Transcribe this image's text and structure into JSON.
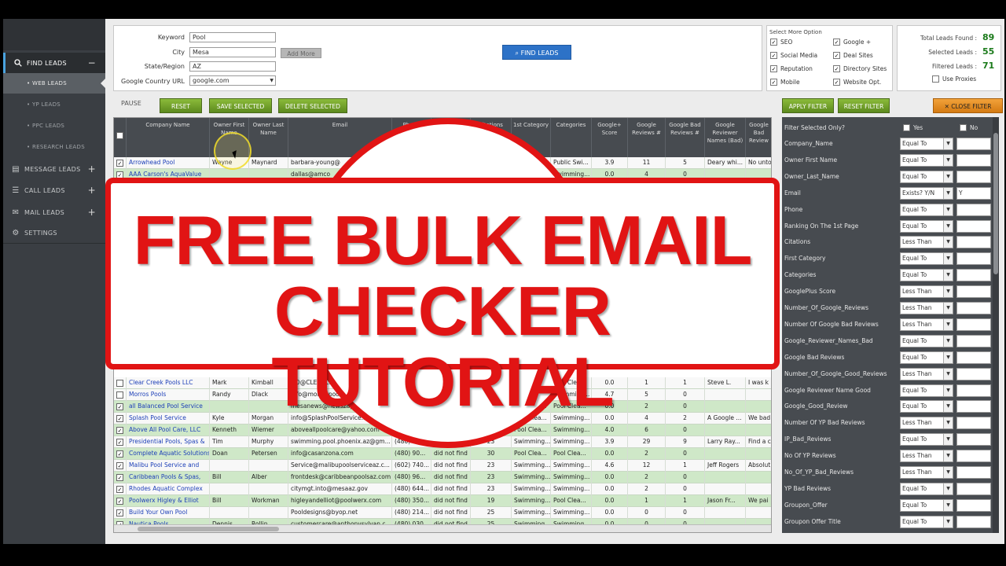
{
  "sidebar": {
    "items": [
      {
        "label": "FIND LEADS",
        "icon": "search-icon",
        "toggle": "−"
      },
      {
        "label": "MESSAGE LEADS",
        "icon": "chat-icon",
        "toggle": "+"
      },
      {
        "label": "CALL LEADS",
        "icon": "phone-list-icon",
        "toggle": "+"
      },
      {
        "label": "MAIL LEADS",
        "icon": "mail-icon",
        "toggle": "+"
      },
      {
        "label": "SETTINGS",
        "icon": "gear-icon",
        "toggle": ""
      }
    ],
    "sub_items": [
      "WEB LEADS",
      "YP LEADS",
      "PPC LEADS",
      "RESEARCH LEADS"
    ]
  },
  "search": {
    "keyword_label": "Keyword",
    "keyword_value": "Pool",
    "city_label": "City",
    "city_value": "Mesa",
    "state_label": "State/Region",
    "state_value": "AZ",
    "country_label": "Google Country URL",
    "country_value": "google.com",
    "add_more": "Add More",
    "find_leads": "FIND LEADS"
  },
  "options": {
    "title": "Select More Option",
    "items": [
      "SEO",
      "Google +",
      "Social Media",
      "Deal Sites",
      "Reputation",
      "Directory Sites",
      "Mobile",
      "Website Opt."
    ]
  },
  "totals": {
    "total_label": "Total Leads Found :",
    "total_value": "89",
    "selected_label": "Selected Leads :",
    "selected_value": "55",
    "filtered_label": "Filtered Leads :",
    "filtered_value": "71",
    "use_proxies": "Use Proxies"
  },
  "toolbar": {
    "pause": "PAUSE",
    "reset": "RESET",
    "save_selected": "SAVE SELECTED",
    "delete_selected": "DELETE SELECTED",
    "apply_filter": "APPLY FILTER",
    "reset_filter": "RESET FILTER",
    "close_filter": "CLOSE FILTER"
  },
  "grid": {
    "columns": [
      "Company Name",
      "Owner First Name",
      "Owner Last Name",
      "Email",
      "Phone",
      "Ranking",
      "Citations",
      "1st Category",
      "Categories",
      "Google+ Score",
      "Google Reviews #",
      "Google Bad Reviews #",
      "Google Reviewer Names (Bad)",
      "Google Bad Review"
    ],
    "top_rows": [
      {
        "checked": true,
        "green": false,
        "company": "Arrowhead Pool",
        "first": "Wayne",
        "last": "Maynard",
        "email": "barbara-young@",
        "phone": "",
        "rank": "",
        "cit": "",
        "cat1": "",
        "cats": "Public Swi...",
        "gscore": "3.9",
        "grev": "11",
        "gbad": "5",
        "gnames": "Deary whi...",
        "gbadrev": "No unto"
      },
      {
        "checked": true,
        "green": true,
        "company": "AAA Carson's AquaValue",
        "first": "",
        "last": "",
        "email": "dallas@amco",
        "phone": "",
        "rank": "",
        "cit": "",
        "cat1": "",
        "cats": "Swimming...",
        "gscore": "0.0",
        "grev": "4",
        "gbad": "0",
        "gnames": "",
        "gbadrev": ""
      }
    ],
    "rows": [
      {
        "checked": false,
        "green": false,
        "company": "Clear Creek Pools LLC",
        "first": "Mark",
        "last": "Kimball",
        "email": "GO@CLEARCR",
        "phone": "",
        "rank": "",
        "cit": "",
        "cat1": "",
        "cats": "Pool Clea...",
        "gscore": "0.0",
        "grev": "1",
        "gbad": "1",
        "gnames": "Steve L.",
        "gbadrev": "I was k"
      },
      {
        "checked": false,
        "green": false,
        "company": "Morros Pools",
        "first": "Randy",
        "last": "Dlack",
        "email": "info@morrospools.",
        "phone": "",
        "rank": "",
        "cit": "",
        "cat1": "",
        "cats": "Swimming...",
        "gscore": "4.7",
        "grev": "5",
        "gbad": "0",
        "gnames": "",
        "gbadrev": ""
      },
      {
        "checked": true,
        "green": true,
        "company": "all Balanced Pool Service",
        "first": "",
        "last": "",
        "email": "mesanews@newszap.com",
        "phone": "",
        "rank": "",
        "cit": "",
        "cat1": "Pool Clea...",
        "cats": "Pool Clea...",
        "gscore": "0.0",
        "grev": "2",
        "gbad": "0",
        "gnames": "",
        "gbadrev": ""
      },
      {
        "checked": true,
        "green": false,
        "company": "Splash Pool Service",
        "first": "Kyle",
        "last": "Morgan",
        "email": "info@SplashPoolService.into",
        "phone": "",
        "rank": "",
        "cit": "",
        "cat1": "Pool Clea...",
        "cats": "Swimming...",
        "gscore": "0.0",
        "grev": "4",
        "gbad": "2",
        "gnames": "A Google ...",
        "gbadrev": "We bad"
      },
      {
        "checked": true,
        "green": true,
        "company": "Above All Pool Care, LLC",
        "first": "Kenneth",
        "last": "Wiemer",
        "email": "aboveallpoolcare@yahoo.com",
        "phone": "(480) 21...",
        "rank": "",
        "cit": "23",
        "cat1": "Pool Clea...",
        "cats": "Swimming...",
        "gscore": "4.0",
        "grev": "6",
        "gbad": "0",
        "gnames": "",
        "gbadrev": ""
      },
      {
        "checked": true,
        "green": false,
        "company": "Presidential Pools, Spas &",
        "first": "Tim",
        "last": "Murphy",
        "email": "swimming.pool.phoenix.az@gm...",
        "phone": "(480) 907...",
        "rank": "did not find",
        "cit": "23",
        "cat1": "Swimming...",
        "cats": "Swimming...",
        "gscore": "3.9",
        "grev": "29",
        "gbad": "9",
        "gnames": "Larry Ray...",
        "gbadrev": "Find a c"
      },
      {
        "checked": true,
        "green": true,
        "company": "Complete Aquatic Solutions",
        "first": "Doan",
        "last": "Petersen",
        "email": "info@casanzona.com",
        "phone": "(480) 90...",
        "rank": "did not find",
        "cit": "30",
        "cat1": "Pool Clea...",
        "cats": "Pool Clea...",
        "gscore": "0.0",
        "grev": "2",
        "gbad": "0",
        "gnames": "",
        "gbadrev": ""
      },
      {
        "checked": true,
        "green": false,
        "company": "Malibu Pool Service and",
        "first": "",
        "last": "",
        "email": "Service@malibupoolserviceaz.c...",
        "phone": "(602) 740...",
        "rank": "did not find",
        "cit": "23",
        "cat1": "Swimming...",
        "cats": "Swimming...",
        "gscore": "4.6",
        "grev": "12",
        "gbad": "1",
        "gnames": "Jeff Rogers",
        "gbadrev": "Absolut"
      },
      {
        "checked": true,
        "green": true,
        "company": "Caribbean Pools & Spas,",
        "first": "Bill",
        "last": "Alber",
        "email": "frontdesk@caribbeanpoolsaz.com",
        "phone": "(480) 96...",
        "rank": "did not find",
        "cit": "23",
        "cat1": "Swimming...",
        "cats": "Swimming...",
        "gscore": "0.0",
        "grev": "2",
        "gbad": "0",
        "gnames": "",
        "gbadrev": ""
      },
      {
        "checked": true,
        "green": false,
        "company": "Rhodes Aquatic Complex",
        "first": "",
        "last": "",
        "email": "citymgt.into@mesaaz.gov",
        "phone": "(480) 644...",
        "rank": "did not find",
        "cit": "23",
        "cat1": "Swimming...",
        "cats": "Swimming...",
        "gscore": "0.0",
        "grev": "2",
        "gbad": "0",
        "gnames": "",
        "gbadrev": ""
      },
      {
        "checked": true,
        "green": true,
        "company": "Poolwerx Higley & Elliot",
        "first": "Bill",
        "last": "Workman",
        "email": "higleyandelliot@poolwerx.com",
        "phone": "(480) 350...",
        "rank": "did not find",
        "cit": "19",
        "cat1": "Swimming...",
        "cats": "Pool Clea...",
        "gscore": "0.0",
        "grev": "1",
        "gbad": "1",
        "gnames": "Jason Fr...",
        "gbadrev": "We pai"
      },
      {
        "checked": true,
        "green": false,
        "company": "Build Your Own Pool",
        "first": "",
        "last": "",
        "email": "Pooldesigns@byop.net",
        "phone": "(480) 214...",
        "rank": "did not find",
        "cit": "25",
        "cat1": "Swimming...",
        "cats": "Swimming...",
        "gscore": "0.0",
        "grev": "0",
        "gbad": "0",
        "gnames": "",
        "gbadrev": ""
      },
      {
        "checked": true,
        "green": true,
        "company": "Nautica Pools",
        "first": "Dennis",
        "last": "Rollin",
        "email": "customercare@anthonysylvan.c...",
        "phone": "(480) 030...",
        "rank": "did not find",
        "cit": "25",
        "cat1": "Swimming...",
        "cats": "Swimming...",
        "gscore": "0.0",
        "grev": "0",
        "gbad": "0",
        "gnames": "",
        "gbadrev": ""
      }
    ]
  },
  "filter": {
    "selected_only": "Filter Selected Only?",
    "yes": "Yes",
    "no": "No",
    "rows": [
      {
        "label": "Company_Name",
        "op": "Equal To",
        "val": ""
      },
      {
        "label": "Owner First Name",
        "op": "Equal To",
        "val": ""
      },
      {
        "label": "Owner_Last_Name",
        "op": "Equal To",
        "val": ""
      },
      {
        "label": "Email",
        "op": "Exists? Y/N",
        "val": "Y"
      },
      {
        "label": "Phone",
        "op": "Equal To",
        "val": ""
      },
      {
        "label": "Ranking On The 1st Page",
        "op": "Equal To",
        "val": ""
      },
      {
        "label": "Citations",
        "op": "Less Than",
        "val": ""
      },
      {
        "label": "First Category",
        "op": "Equal To",
        "val": ""
      },
      {
        "label": "Categories",
        "op": "Equal To",
        "val": ""
      },
      {
        "label": "GooglePlus Score",
        "op": "Less Than",
        "val": ""
      },
      {
        "label": "Number_Of_Google_Reviews",
        "op": "Less Than",
        "val": ""
      },
      {
        "label": "Number Of Google Bad Reviews",
        "op": "Less Than",
        "val": ""
      },
      {
        "label": "Google_Reviewer_Names_Bad",
        "op": "Equal To",
        "val": ""
      },
      {
        "label": "Google Bad Reviews",
        "op": "Equal To",
        "val": ""
      },
      {
        "label": "Number_Of_Google_Good_Reviews",
        "op": "Less Than",
        "val": ""
      },
      {
        "label": "Google Reviewer Name Good",
        "op": "Equal To",
        "val": ""
      },
      {
        "label": "Google_Good_Review",
        "op": "Equal To",
        "val": ""
      },
      {
        "label": "Number Of YP Bad Reviews",
        "op": "Less Than",
        "val": ""
      },
      {
        "label": "IP_Bad_Reviews",
        "op": "Equal To",
        "val": ""
      },
      {
        "label": "No Of YP Reviews",
        "op": "Less Than",
        "val": ""
      },
      {
        "label": "No_Of_YP_Bad_Reviews",
        "op": "Less Than",
        "val": ""
      },
      {
        "label": "YP Bad Reviews",
        "op": "Equal To",
        "val": ""
      },
      {
        "label": "Groupon_Offer",
        "op": "Equal To",
        "val": ""
      },
      {
        "label": "Groupon Offer Title",
        "op": "Equal To",
        "val": ""
      }
    ]
  },
  "overlay": {
    "line1": "FREE BULK EMAIL",
    "line2": "CHECKER TUTORIAL"
  },
  "colors": {
    "accent_red": "#e11414",
    "sidebar": "#3a3e43",
    "button_green": "#6f9f2a",
    "find_blue": "#2d72c7",
    "row_green": "#cfe8c8"
  }
}
